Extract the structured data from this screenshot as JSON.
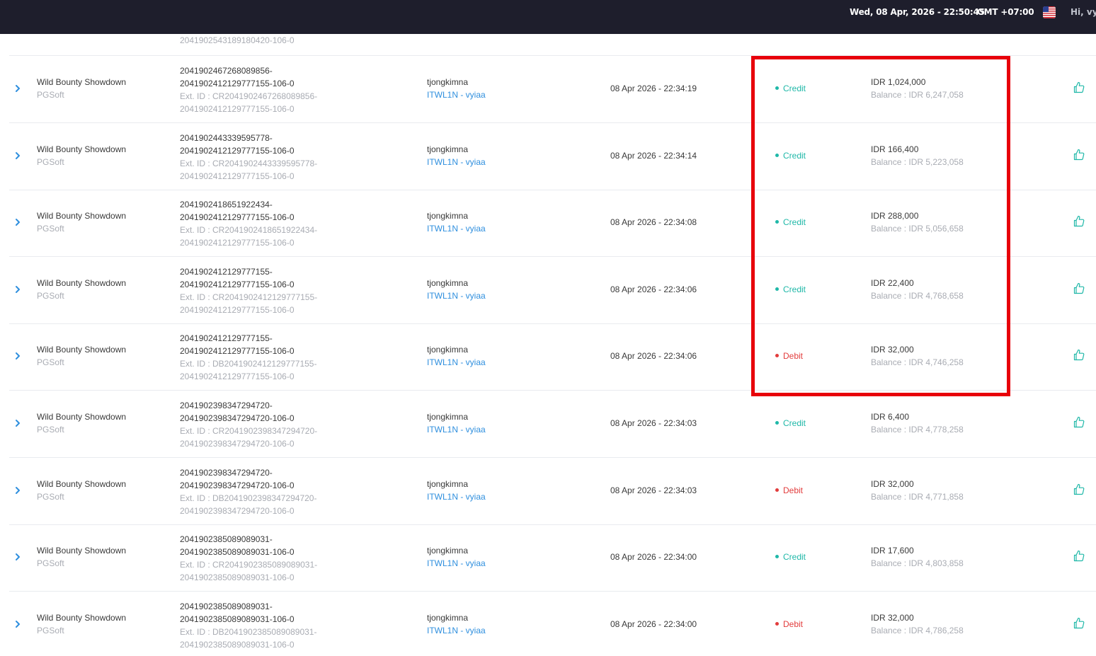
{
  "header": {
    "datetime": "Wed, 08 Apr, 2026 - 22:50:45",
    "timezone": "GMT +07:00",
    "greeting": "Hi, vyia",
    "language_icon": "us-flag-icon"
  },
  "partial_row": {
    "ref_tail": "2041902543189180420-106-0"
  },
  "colors": {
    "credit": "#1fb8a8",
    "debit": "#e23c3c",
    "link": "#2f8fde",
    "highlight": "#e8000b"
  },
  "highlight_box": "annotation around Credit/Debit type and amount columns",
  "rows": [
    {
      "game": "Wild Bounty Showdown",
      "provider": "PGSoft",
      "ref1": "2041902467268089856-",
      "ref2": "2041902412129777155-106-0",
      "ext1": "Ext. ID : CR2041902467268089856-",
      "ext2": "2041902412129777155-106-0",
      "user": "tjongkimna",
      "agent": "ITWL1N - vyiaa",
      "time": "08 Apr 2026 - 22:34:19",
      "type": "Credit",
      "amount": "IDR 1,024,000",
      "balance": "Balance : IDR 6,247,058"
    },
    {
      "game": "Wild Bounty Showdown",
      "provider": "PGSoft",
      "ref1": "2041902443339595778-",
      "ref2": "2041902412129777155-106-0",
      "ext1": "Ext. ID : CR2041902443339595778-",
      "ext2": "2041902412129777155-106-0",
      "user": "tjongkimna",
      "agent": "ITWL1N - vyiaa",
      "time": "08 Apr 2026 - 22:34:14",
      "type": "Credit",
      "amount": "IDR 166,400",
      "balance": "Balance : IDR 5,223,058"
    },
    {
      "game": "Wild Bounty Showdown",
      "provider": "PGSoft",
      "ref1": "2041902418651922434-",
      "ref2": "2041902412129777155-106-0",
      "ext1": "Ext. ID : CR2041902418651922434-",
      "ext2": "2041902412129777155-106-0",
      "user": "tjongkimna",
      "agent": "ITWL1N - vyiaa",
      "time": "08 Apr 2026 - 22:34:08",
      "type": "Credit",
      "amount": "IDR 288,000",
      "balance": "Balance : IDR 5,056,658"
    },
    {
      "game": "Wild Bounty Showdown",
      "provider": "PGSoft",
      "ref1": "2041902412129777155-",
      "ref2": "2041902412129777155-106-0",
      "ext1": "Ext. ID : CR2041902412129777155-",
      "ext2": "2041902412129777155-106-0",
      "user": "tjongkimna",
      "agent": "ITWL1N - vyiaa",
      "time": "08 Apr 2026 - 22:34:06",
      "type": "Credit",
      "amount": "IDR 22,400",
      "balance": "Balance : IDR 4,768,658"
    },
    {
      "game": "Wild Bounty Showdown",
      "provider": "PGSoft",
      "ref1": "2041902412129777155-",
      "ref2": "2041902412129777155-106-0",
      "ext1": "Ext. ID : DB2041902412129777155-",
      "ext2": "2041902412129777155-106-0",
      "user": "tjongkimna",
      "agent": "ITWL1N - vyiaa",
      "time": "08 Apr 2026 - 22:34:06",
      "type": "Debit",
      "amount": "IDR 32,000",
      "balance": "Balance : IDR 4,746,258"
    },
    {
      "game": "Wild Bounty Showdown",
      "provider": "PGSoft",
      "ref1": "2041902398347294720-",
      "ref2": "2041902398347294720-106-0",
      "ext1": "Ext. ID : CR2041902398347294720-",
      "ext2": "2041902398347294720-106-0",
      "user": "tjongkimna",
      "agent": "ITWL1N - vyiaa",
      "time": "08 Apr 2026 - 22:34:03",
      "type": "Credit",
      "amount": "IDR 6,400",
      "balance": "Balance : IDR 4,778,258"
    },
    {
      "game": "Wild Bounty Showdown",
      "provider": "PGSoft",
      "ref1": "2041902398347294720-",
      "ref2": "2041902398347294720-106-0",
      "ext1": "Ext. ID : DB2041902398347294720-",
      "ext2": "2041902398347294720-106-0",
      "user": "tjongkimna",
      "agent": "ITWL1N - vyiaa",
      "time": "08 Apr 2026 - 22:34:03",
      "type": "Debit",
      "amount": "IDR 32,000",
      "balance": "Balance : IDR 4,771,858"
    },
    {
      "game": "Wild Bounty Showdown",
      "provider": "PGSoft",
      "ref1": "2041902385089089031-",
      "ref2": "2041902385089089031-106-0",
      "ext1": "Ext. ID : CR2041902385089089031-",
      "ext2": "2041902385089089031-106-0",
      "user": "tjongkimna",
      "agent": "ITWL1N - vyiaa",
      "time": "08 Apr 2026 - 22:34:00",
      "type": "Credit",
      "amount": "IDR 17,600",
      "balance": "Balance : IDR 4,803,858"
    },
    {
      "game": "Wild Bounty Showdown",
      "provider": "PGSoft",
      "ref1": "2041902385089089031-",
      "ref2": "2041902385089089031-106-0",
      "ext1": "Ext. ID : DB2041902385089089031-",
      "ext2": "2041902385089089031-106-0",
      "user": "tjongkimna",
      "agent": "ITWL1N - vyiaa",
      "time": "08 Apr 2026 - 22:34:00",
      "type": "Debit",
      "amount": "IDR 32,000",
      "balance": "Balance : IDR 4,786,258"
    }
  ]
}
